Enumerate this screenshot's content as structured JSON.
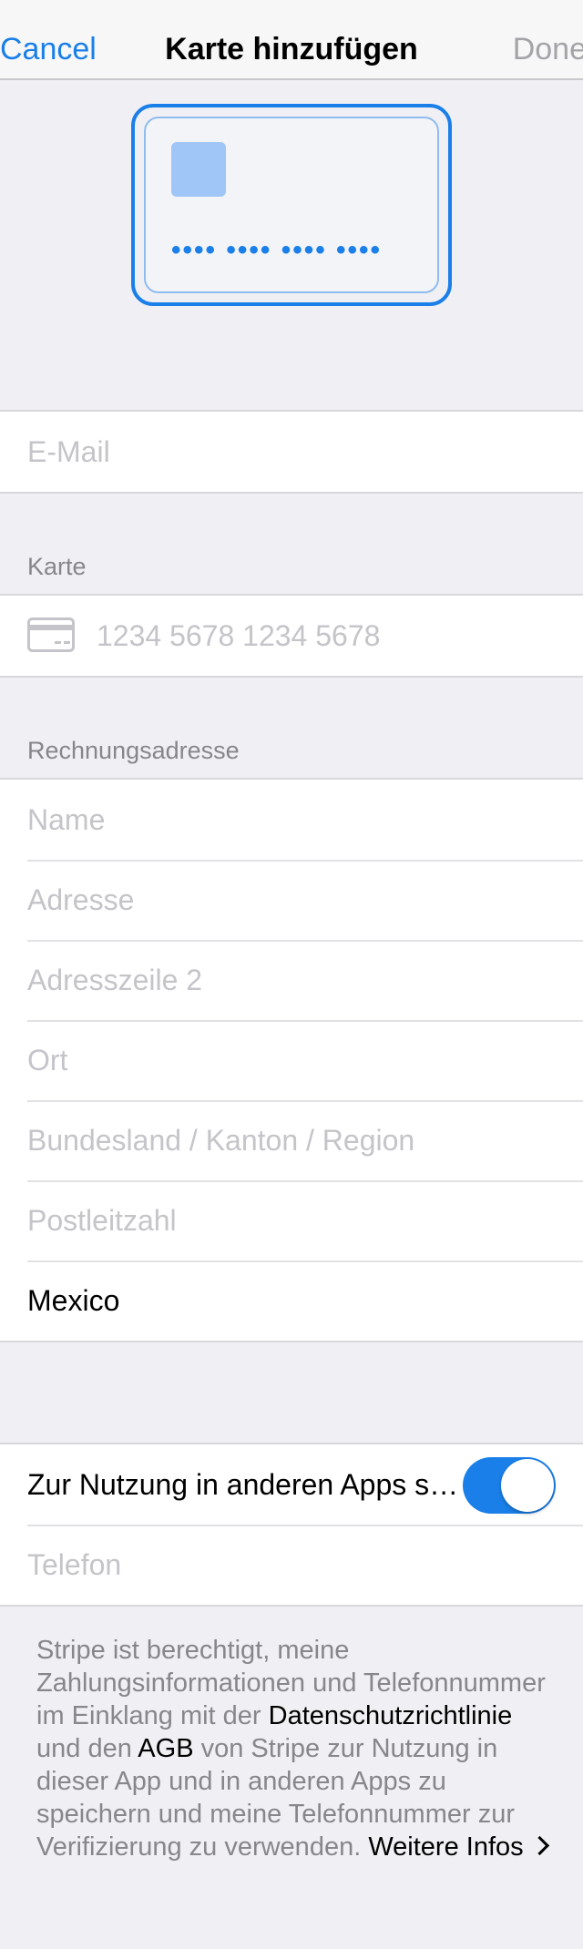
{
  "navbar": {
    "cancel_label": "Cancel",
    "title": "Karte hinzufügen",
    "done_label": "Done"
  },
  "card_preview": {
    "number_mask": "•••• •••• •••• ••••"
  },
  "email": {
    "placeholder": "E-Mail"
  },
  "card_section": {
    "header": "Karte",
    "number_placeholder": "1234 5678 1234 5678"
  },
  "billing": {
    "header": "Rechnungsadresse",
    "fields": [
      {
        "placeholder": "Name"
      },
      {
        "placeholder": "Adresse"
      },
      {
        "placeholder": "Adresszeile 2"
      },
      {
        "placeholder": "Ort"
      },
      {
        "placeholder": "Bundesland / Kanton / Region"
      },
      {
        "placeholder": "Postleitzahl"
      }
    ],
    "country": "Mexico"
  },
  "link": {
    "toggle_label": "Zur Nutzung in anderen Apps speichern",
    "toggle_on": true,
    "phone_placeholder": "Telefon"
  },
  "footer": {
    "text_1": "Stripe ist berechtigt, meine Zahlungsinformationen und Telefonnummer im Einklang mit der ",
    "privacy_link": "Datenschutzrichtlinie",
    "text_2": " und den ",
    "terms_link": "AGB",
    "text_3": " von Stripe zur Nutzung in dieser App und in anderen Apps zu speichern und meine Telefonnummer zur Verifizierung zu verwenden. ",
    "more_link": "Weitere Infos"
  },
  "colors": {
    "accent": "#1a7fe8",
    "disabled": "#a3a3a8",
    "placeholder": "#c4c4c9",
    "background": "#f0f0f4"
  }
}
